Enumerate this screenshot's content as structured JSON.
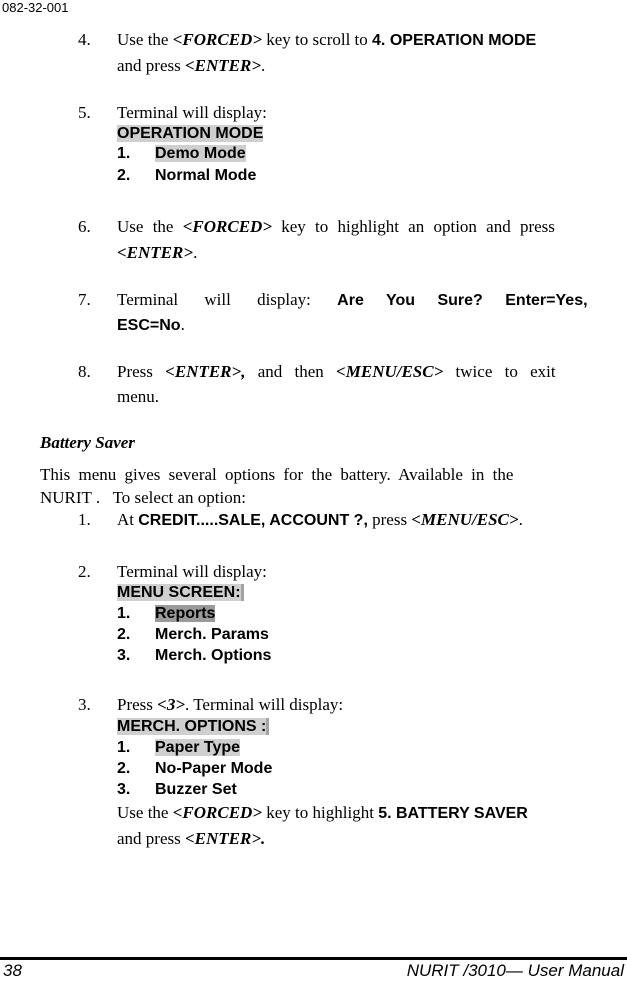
{
  "header": {
    "doc_id": "082-32-001"
  },
  "steps_top": [
    {
      "num": "4.",
      "parts": [
        "Use the ",
        "<FORCED>",
        " key to scroll to ",
        "4. OPERATION MODE"
      ],
      "line2": [
        "and press ",
        "<ENTER>",
        "."
      ]
    },
    {
      "num": "5.",
      "text": "Terminal will display:",
      "screen": {
        "title": "OPERATION MODE",
        "items": [
          {
            "n": "1.",
            "label": "Demo Mode"
          },
          {
            "n": "2.",
            "label": "Normal Mode"
          }
        ]
      }
    },
    {
      "num": "6.",
      "parts": [
        "Use the ",
        "<FORCED>",
        " key to highlight an option and press"
      ],
      "line2": [
        "<ENTER>",
        "."
      ]
    },
    {
      "num": "7.",
      "parts": [
        "Terminal will display: ",
        "Are You Sure? Enter=Yes,"
      ],
      "line2": [
        "ESC=No",
        "."
      ]
    },
    {
      "num": "8.",
      "parts": [
        "Press ",
        "<ENTER>,",
        " and then ",
        "<MENU/ESC>",
        " twice to exit"
      ],
      "line2": [
        "menu."
      ]
    }
  ],
  "section": {
    "heading": "Battery Saver",
    "intro_line1": "This menu gives several options for the battery.  Available in the",
    "intro_line2": "NURIT .   To select an option:"
  },
  "steps_bottom": [
    {
      "num": "1.",
      "parts": [
        "At ",
        "CREDIT.....SALE, ACCOUNT ?,",
        " press ",
        "<MENU/ESC>",
        "."
      ]
    },
    {
      "num": "2.",
      "text": "Terminal will display:",
      "screen": {
        "title": "MENU SCREEN",
        "colon": ":",
        "items": [
          {
            "n": "1.",
            "label": "Reports"
          },
          {
            "n": "2.",
            "label": "Merch. Params"
          },
          {
            "n": "3.",
            "label": "Merch. Options"
          }
        ]
      }
    },
    {
      "num": "3.",
      "parts": [
        "Press ",
        "<3>",
        ". Terminal will display:"
      ],
      "screen": {
        "title": "MERCH. OPTIONS ",
        "colon": ":",
        "items": [
          {
            "n": "1.",
            "label": "Paper Type"
          },
          {
            "n": "2.",
            "label": "No-Paper Mode"
          },
          {
            "n": "3.",
            "label": "Buzzer Set"
          }
        ]
      },
      "after_line1": [
        "Use the ",
        "<FORCED>",
        " key to highlight ",
        "5. BATTERY SAVER"
      ],
      "after_line2": [
        "and press ",
        "<ENTER>."
      ]
    }
  ],
  "footer": {
    "page_number": "38",
    "title": "NURIT /3010— User Manual"
  }
}
